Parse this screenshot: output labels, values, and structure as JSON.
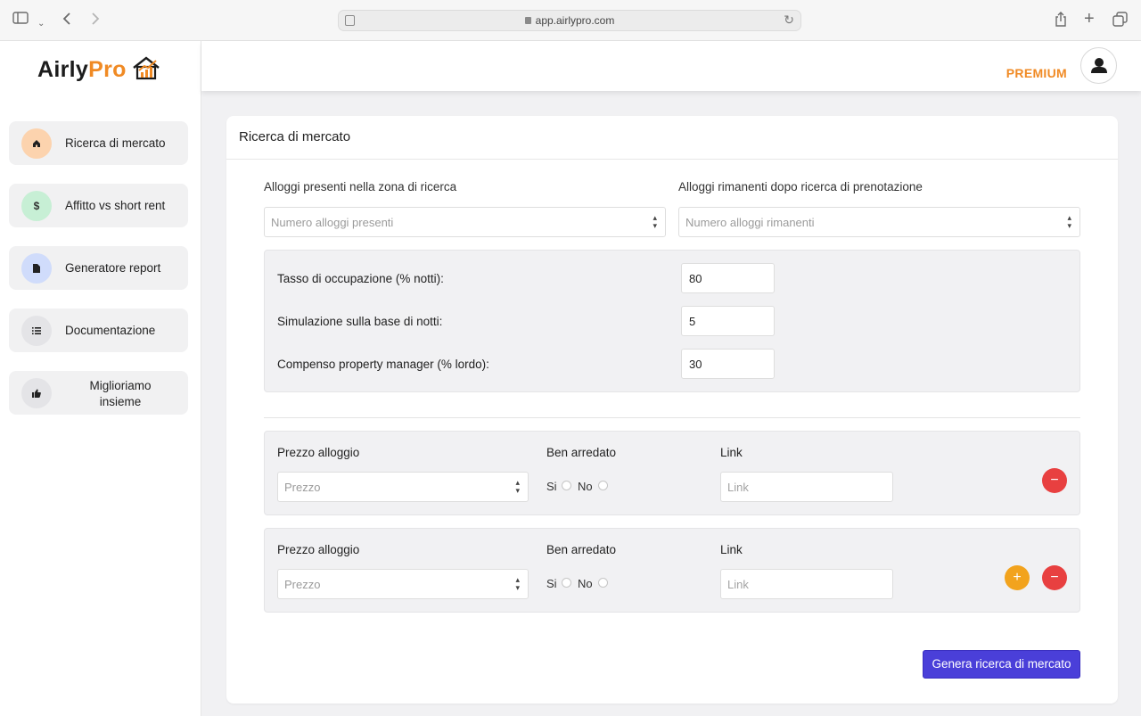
{
  "browser": {
    "url": "app.airlypro.com"
  },
  "brand": {
    "name_part1": "Airly",
    "name_part2": "Pro",
    "accent_color": "#f08a24"
  },
  "sidebar": {
    "items": [
      {
        "label": "Ricerca di mercato",
        "icon": "home-icon",
        "icon_glyph": "⌂",
        "circle_color": "#fcd3ae"
      },
      {
        "label": "Affitto vs short rent",
        "icon": "dollar-icon",
        "icon_glyph": "$",
        "circle_color": "#c7efd5"
      },
      {
        "label": "Generatore report",
        "icon": "document-icon",
        "icon_glyph": "▪",
        "circle_color": "#d0dcfb"
      },
      {
        "label": "Documentazione",
        "icon": "list-icon",
        "icon_glyph": "☰",
        "circle_color": "#e4e4e7"
      },
      {
        "label": "Miglioriamo insieme",
        "icon": "thumbs-up-icon",
        "icon_glyph": "👍",
        "circle_color": "#e4e4e7"
      }
    ]
  },
  "header": {
    "plan_badge": "PREMIUM"
  },
  "main": {
    "title": "Ricerca di mercato",
    "alloggi_presenti": {
      "label": "Alloggi presenti nella zona di ricerca",
      "placeholder": "Numero alloggi presenti"
    },
    "alloggi_rimanenti": {
      "label": "Alloggi rimanenti dopo ricerca di prenotazione",
      "placeholder": "Numero alloggi rimanenti"
    },
    "params": [
      {
        "label": "Tasso di occupazione (% notti):",
        "value": "80"
      },
      {
        "label": "Simulazione sulla base di notti:",
        "value": "5"
      },
      {
        "label": "Compenso property manager (% lordo):",
        "value": "30"
      }
    ],
    "listings": [
      {
        "price_label": "Prezzo alloggio",
        "price_placeholder": "Prezzo",
        "furnished_label": "Ben arredato",
        "option_yes": "Si",
        "option_no": "No",
        "link_label": "Link",
        "link_placeholder": "Link"
      },
      {
        "price_label": "Prezzo alloggio",
        "price_placeholder": "Prezzo",
        "furnished_label": "Ben arredato",
        "option_yes": "Si",
        "option_no": "No",
        "link_label": "Link",
        "link_placeholder": "Link"
      }
    ],
    "submit_label": "Genera ricerca di mercato",
    "submit_color": "#4a3fd9"
  }
}
